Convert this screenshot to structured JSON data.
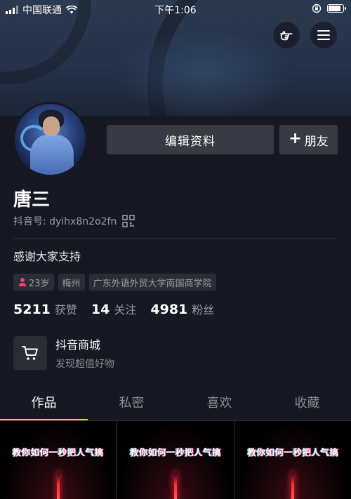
{
  "status_bar": {
    "carrier": "中国联通",
    "time": "下午1:06"
  },
  "profile": {
    "edit_label": "编辑资料",
    "friend_label": "朋友",
    "friend_plus": "+",
    "name": "唐三",
    "id_label": "抖音号: dyihx8n2o2fn",
    "bio": "感谢大家支持"
  },
  "tags": [
    {
      "text": "23岁",
      "icon": "female-icon"
    },
    {
      "text": "梅州"
    },
    {
      "text": "广东外语外贸大学南国商学院"
    }
  ],
  "stats": {
    "likes": {
      "num": "5211",
      "label": "获赞"
    },
    "following": {
      "num": "14",
      "label": "关注"
    },
    "followers": {
      "num": "4981",
      "label": "粉丝"
    }
  },
  "shop": {
    "title": "抖音商城",
    "subtitle": "发现超值好物"
  },
  "tabs": [
    {
      "label": "作品",
      "active": true
    },
    {
      "label": "私密"
    },
    {
      "label": "喜欢"
    },
    {
      "label": "收藏"
    }
  ],
  "videos": [
    {
      "caption": "教你如何一秒把人气搞"
    },
    {
      "caption": "教你如何一秒把人气搞"
    },
    {
      "caption": "教你如何一秒把人气搞"
    }
  ],
  "colors": {
    "background": "#161823",
    "button": "#393b44",
    "tab_indicator": "#f2c030",
    "muted_text": "#9b9ca3",
    "female_icon": "#f2456b"
  }
}
